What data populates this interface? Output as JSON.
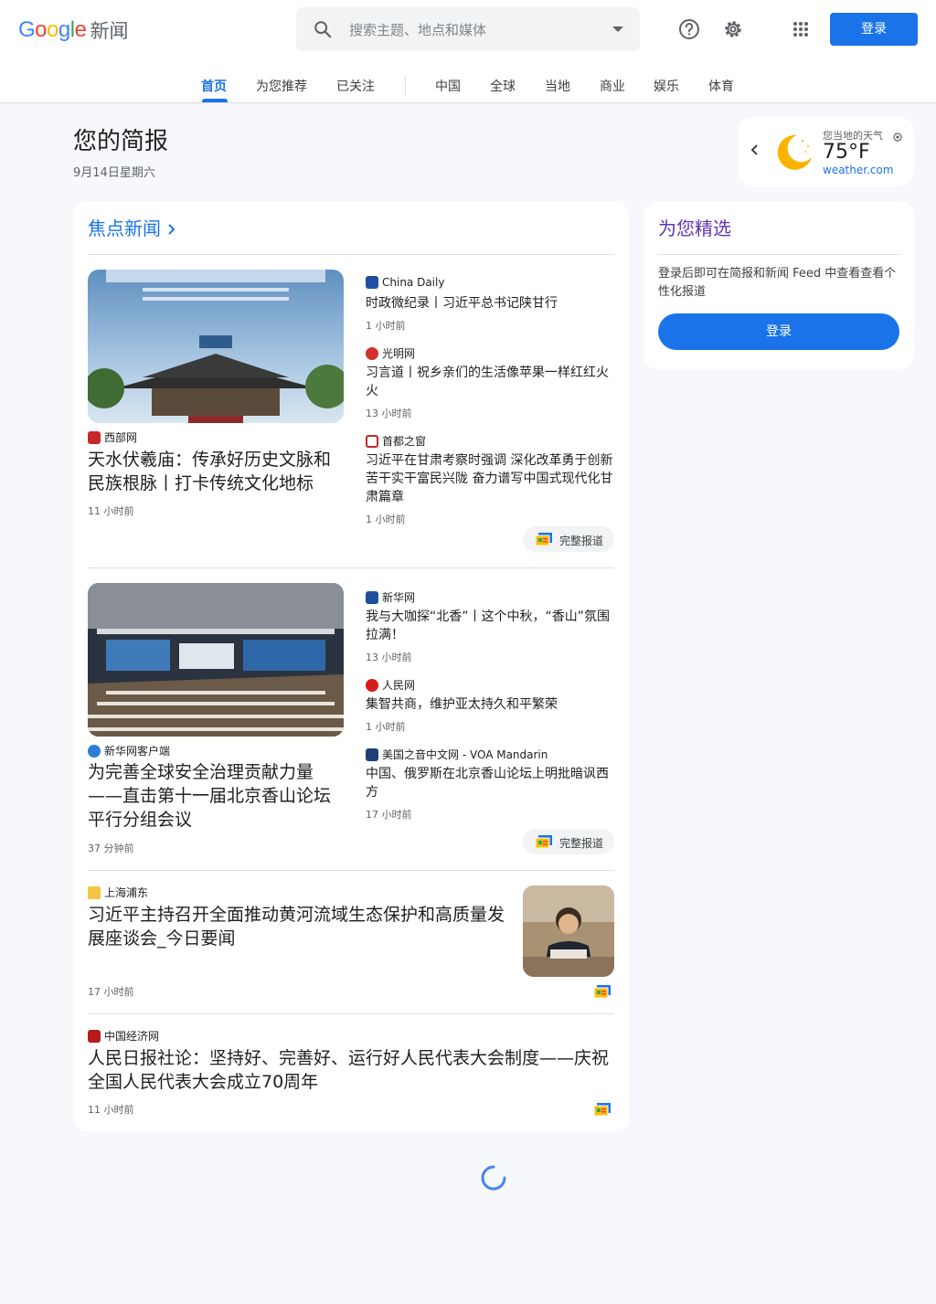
{
  "header": {
    "logo_google": "Google",
    "logo_news": "新闻",
    "search_placeholder": "搜索主题、地点和媒体",
    "signin_label": "登录",
    "icons": [
      "search-icon",
      "help-icon",
      "settings-icon",
      "apps-icon"
    ]
  },
  "nav": {
    "tabs": [
      "首页",
      "为您推荐",
      "已关注",
      "中国",
      "全球",
      "当地",
      "商业",
      "娱乐",
      "体育"
    ],
    "active": "首页"
  },
  "briefing": {
    "title": "您的简报",
    "date": "9月14日星期六"
  },
  "weather": {
    "label": "您当地的天气",
    "temp": "75°F",
    "source": "weather.com",
    "icon": "moon-icon"
  },
  "top_stories": {
    "title": "焦点新闻",
    "full_coverage_label": "完整报道",
    "clusters": [
      {
        "main": {
          "source": "西部网",
          "headline": "天水伏羲庙：传承好历史文脉和民族根脉丨打卡传统文化地标",
          "time": "11 小时前"
        },
        "side": [
          {
            "source": "China Daily",
            "headline": "时政微纪录丨习近平总书记陕甘行",
            "time": "1 小时前"
          },
          {
            "source": "光明网",
            "headline": "习言道丨祝乡亲们的生活像苹果一样红红火火",
            "time": "13 小时前"
          },
          {
            "source": "首都之窗",
            "headline": "习近平在甘肃考察时强调 深化改革勇于创新 苦干实干富民兴陇 奋力谱写中国式现代化甘肃篇章",
            "time": "1 小时前"
          }
        ]
      },
      {
        "main": {
          "source": "新华网客户端",
          "headline": "为完善全球安全治理贡献力量——直击第十一届北京香山论坛平行分组会议",
          "time": "37 分钟前"
        },
        "side": [
          {
            "source": "新华网",
            "headline": "我与大咖探“北香”丨这个中秋，“香山”氛围拉满！",
            "time": "13 小时前"
          },
          {
            "source": "人民网",
            "headline": "集智共商，维护亚太持久和平繁荣",
            "time": "1 小时前"
          },
          {
            "source": "美国之音中文网 - VOA Mandarin",
            "headline": "中国、俄罗斯在北京香山论坛上明批暗讽西方",
            "time": "17 小时前"
          }
        ]
      }
    ],
    "singles": [
      {
        "source": "上海浦东",
        "headline": "习近平主持召开全面推动黄河流域生态保护和高质量发展座谈会_今日要闻",
        "time": "17 小时前"
      },
      {
        "source": "中国经济网",
        "headline": "人民日报社论：坚持好、完善好、运行好人民代表大会制度——庆祝全国人民代表大会成立70周年",
        "time": "11 小时前"
      }
    ]
  },
  "picks": {
    "title": "为您精选",
    "text": "登录后即可在简报和新闻 Feed 中查看查看个性化报道",
    "signin_label": "登录"
  },
  "colors": {
    "accent": "#1a73e8",
    "picks_title": "#5e35b1",
    "background": "#f6f8fc"
  }
}
